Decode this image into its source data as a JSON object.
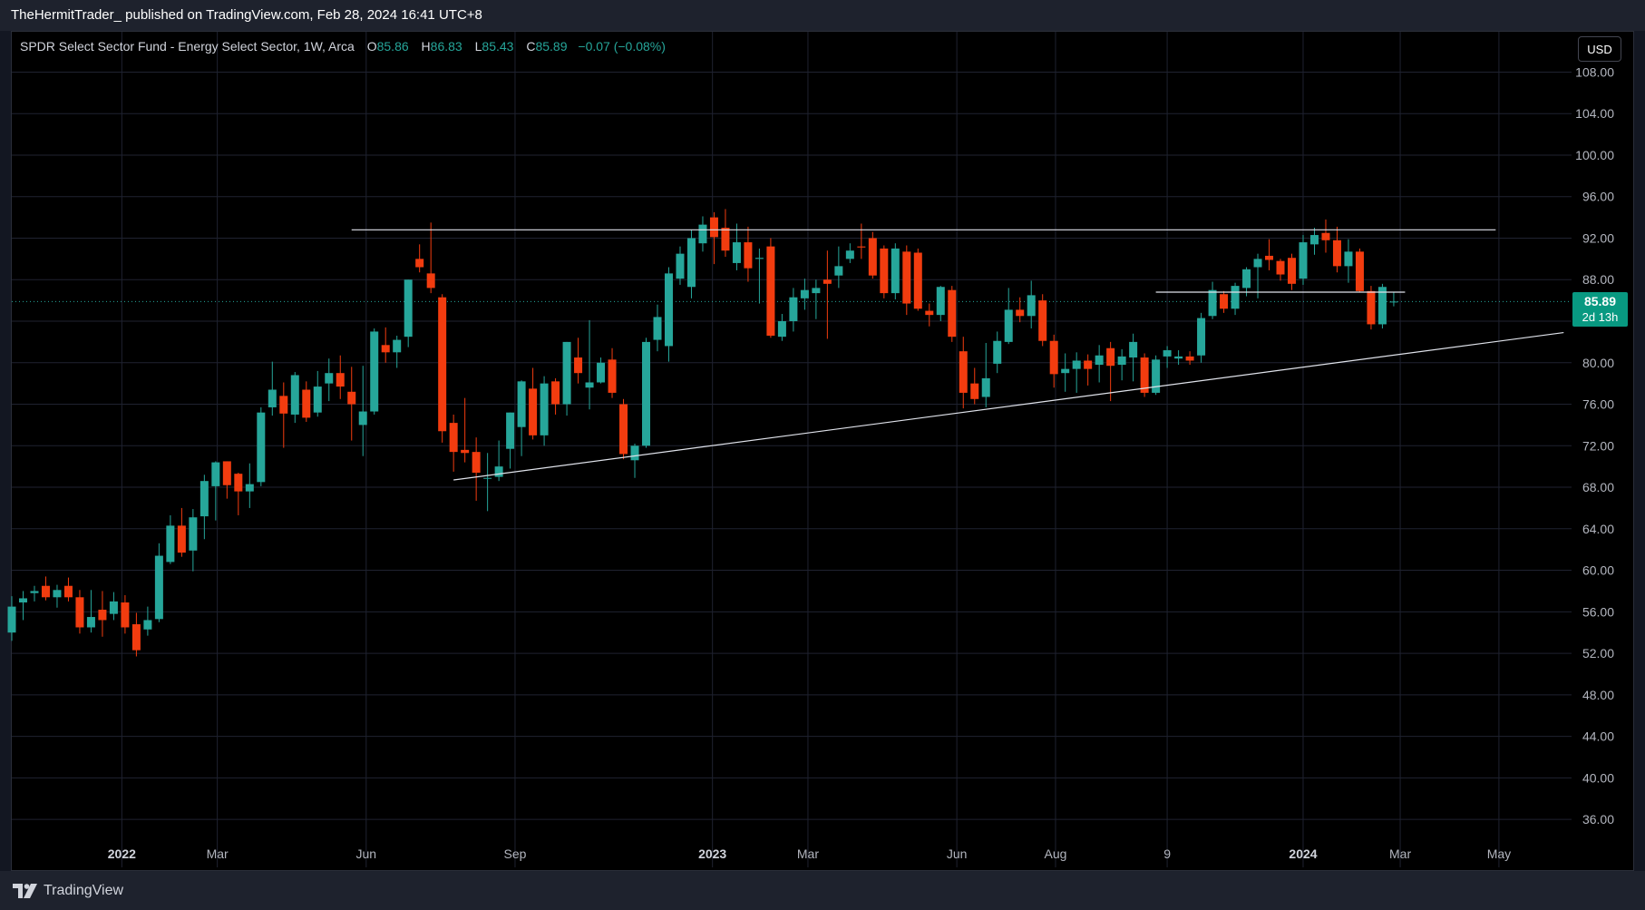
{
  "header": {
    "published_by": "TheHermitTrader_ published on TradingView.com, Feb 28, 2024 16:41 UTC+8"
  },
  "legend": {
    "symbol": "SPDR Select Sector Fund - Energy Select Sector, 1W, Arca",
    "open_key": "O",
    "open": "85.86",
    "high_key": "H",
    "high": "86.83",
    "low_key": "L",
    "low": "85.43",
    "close_key": "C",
    "close": "85.89",
    "change": "−0.07 (−0.08%)"
  },
  "currency_button": "USD",
  "price_badge": {
    "price": "85.89",
    "countdown": "2d 13h"
  },
  "footer": {
    "brand": "TradingView",
    "logo_icon": "tradingview-logo-icon"
  },
  "colors": {
    "up": "#26a69a",
    "down": "#f23c0f",
    "background": "#000000",
    "grid": "#1f2230",
    "axis_text": "#b2b5be",
    "trendline": "#e0e3eb",
    "last_price_line": "#26a69a"
  },
  "chart_data": {
    "type": "candlestick",
    "timeframe": "1W",
    "x_range": [
      "2021-10-25",
      "2024-06-16"
    ],
    "ylim": [
      34,
      109
    ],
    "y_ticks": [
      "108.00",
      "104.00",
      "100.00",
      "96.00",
      "92.00",
      "88.00",
      "84.00",
      "80.00",
      "76.00",
      "72.00",
      "68.00",
      "64.00",
      "60.00",
      "56.00",
      "52.00",
      "48.00",
      "44.00",
      "40.00",
      "36.00"
    ],
    "x_ticks": [
      {
        "date": "2022-01-01",
        "label": "2022",
        "bold": true
      },
      {
        "date": "2022-03-01",
        "label": "Mar"
      },
      {
        "date": "2022-06-01",
        "label": "Jun"
      },
      {
        "date": "2022-09-01",
        "label": "Sep"
      },
      {
        "date": "2023-01-01",
        "label": "2023",
        "bold": true
      },
      {
        "date": "2023-03-01",
        "label": "Mar"
      },
      {
        "date": "2023-06-01",
        "label": "Jun"
      },
      {
        "date": "2023-08-01",
        "label": "Aug"
      },
      {
        "date": "2023-10-09",
        "label": "9"
      },
      {
        "date": "2024-01-01",
        "label": "2024",
        "bold": true
      },
      {
        "date": "2024-03-01",
        "label": "Mar"
      },
      {
        "date": "2024-05-01",
        "label": "May"
      }
    ],
    "last_price": 85.89,
    "grid": true,
    "candles": [
      {
        "date": "2021-10-25",
        "o": 54.0,
        "h": 57.5,
        "l": 53.2,
        "c": 56.5
      },
      {
        "date": "2021-11-01",
        "o": 56.9,
        "h": 58.0,
        "l": 55.2,
        "c": 57.3
      },
      {
        "date": "2021-11-08",
        "o": 57.8,
        "h": 58.5,
        "l": 57.0,
        "c": 58.0
      },
      {
        "date": "2021-11-15",
        "o": 58.5,
        "h": 59.4,
        "l": 57.1,
        "c": 57.4
      },
      {
        "date": "2021-11-22",
        "o": 57.4,
        "h": 58.6,
        "l": 56.4,
        "c": 58.1
      },
      {
        "date": "2021-11-29",
        "o": 58.5,
        "h": 59.3,
        "l": 57.0,
        "c": 57.4
      },
      {
        "date": "2021-12-06",
        "o": 57.4,
        "h": 58.1,
        "l": 53.9,
        "c": 54.5
      },
      {
        "date": "2021-12-13",
        "o": 54.5,
        "h": 58.1,
        "l": 54.0,
        "c": 55.5
      },
      {
        "date": "2021-12-20",
        "o": 56.2,
        "h": 58.0,
        "l": 53.6,
        "c": 55.2
      },
      {
        "date": "2021-12-27",
        "o": 55.8,
        "h": 57.9,
        "l": 55.2,
        "c": 57.0
      },
      {
        "date": "2022-01-03",
        "o": 56.9,
        "h": 57.6,
        "l": 53.9,
        "c": 54.5
      },
      {
        "date": "2022-01-10",
        "o": 54.8,
        "h": 55.9,
        "l": 51.7,
        "c": 52.3
      },
      {
        "date": "2022-01-17",
        "o": 54.3,
        "h": 56.5,
        "l": 53.7,
        "c": 55.2
      },
      {
        "date": "2022-01-24",
        "o": 55.3,
        "h": 62.6,
        "l": 55.0,
        "c": 61.4
      },
      {
        "date": "2022-01-31",
        "o": 60.8,
        "h": 65.3,
        "l": 60.6,
        "c": 64.3
      },
      {
        "date": "2022-02-07",
        "o": 64.3,
        "h": 66.0,
        "l": 61.3,
        "c": 61.7
      },
      {
        "date": "2022-02-14",
        "o": 61.9,
        "h": 65.9,
        "l": 59.9,
        "c": 65.1
      },
      {
        "date": "2022-02-21",
        "o": 65.2,
        "h": 69.2,
        "l": 63.0,
        "c": 68.6
      },
      {
        "date": "2022-02-28",
        "o": 68.1,
        "h": 70.5,
        "l": 64.8,
        "c": 70.4
      },
      {
        "date": "2022-03-07",
        "o": 70.5,
        "h": 70.5,
        "l": 66.9,
        "c": 68.2
      },
      {
        "date": "2022-03-14",
        "o": 69.3,
        "h": 69.4,
        "l": 65.3,
        "c": 67.6
      },
      {
        "date": "2022-03-21",
        "o": 67.6,
        "h": 70.3,
        "l": 66.0,
        "c": 68.3
      },
      {
        "date": "2022-03-28",
        "o": 68.5,
        "h": 75.7,
        "l": 68.1,
        "c": 75.2
      },
      {
        "date": "2022-04-04",
        "o": 75.7,
        "h": 80.1,
        "l": 74.9,
        "c": 77.4
      },
      {
        "date": "2022-04-11",
        "o": 76.8,
        "h": 78.1,
        "l": 71.8,
        "c": 75.1
      },
      {
        "date": "2022-04-18",
        "o": 75.0,
        "h": 79.1,
        "l": 74.2,
        "c": 78.8
      },
      {
        "date": "2022-04-25",
        "o": 77.4,
        "h": 78.2,
        "l": 74.3,
        "c": 74.7
      },
      {
        "date": "2022-05-02",
        "o": 75.2,
        "h": 79.2,
        "l": 74.8,
        "c": 77.7
      },
      {
        "date": "2022-05-09",
        "o": 78.0,
        "h": 80.4,
        "l": 76.3,
        "c": 79.0
      },
      {
        "date": "2022-05-16",
        "o": 79.0,
        "h": 80.7,
        "l": 76.5,
        "c": 77.7
      },
      {
        "date": "2022-05-23",
        "o": 77.2,
        "h": 79.6,
        "l": 72.5,
        "c": 76.0
      },
      {
        "date": "2022-05-30",
        "o": 74.0,
        "h": 79.7,
        "l": 71.0,
        "c": 75.3
      },
      {
        "date": "2022-06-06",
        "o": 75.3,
        "h": 83.3,
        "l": 75.0,
        "c": 83.0
      },
      {
        "date": "2022-06-13",
        "o": 81.7,
        "h": 83.4,
        "l": 80.0,
        "c": 81.0
      },
      {
        "date": "2022-06-20",
        "o": 81.0,
        "h": 82.6,
        "l": 79.5,
        "c": 82.2
      },
      {
        "date": "2022-06-27",
        "o": 82.5,
        "h": 88.0,
        "l": 81.5,
        "c": 88.0
      },
      {
        "date": "2022-07-04",
        "o": 90.0,
        "h": 91.4,
        "l": 88.7,
        "c": 89.2
      },
      {
        "date": "2022-07-11",
        "o": 88.6,
        "h": 93.5,
        "l": 86.7,
        "c": 87.2
      },
      {
        "date": "2022-07-18",
        "o": 86.3,
        "h": 86.6,
        "l": 72.3,
        "c": 73.4
      },
      {
        "date": "2022-07-25",
        "o": 74.2,
        "h": 75.0,
        "l": 69.5,
        "c": 71.4
      },
      {
        "date": "2022-08-01",
        "o": 71.6,
        "h": 76.6,
        "l": 70.4,
        "c": 71.3
      },
      {
        "date": "2022-08-08",
        "o": 71.4,
        "h": 72.8,
        "l": 66.7,
        "c": 69.4
      },
      {
        "date": "2022-08-15",
        "o": 68.9,
        "h": 71.3,
        "l": 65.7,
        "c": 68.9
      },
      {
        "date": "2022-08-22",
        "o": 69.0,
        "h": 72.5,
        "l": 68.6,
        "c": 70.0
      },
      {
        "date": "2022-08-29",
        "o": 71.7,
        "h": 75.2,
        "l": 69.8,
        "c": 75.2
      },
      {
        "date": "2022-09-05",
        "o": 73.8,
        "h": 78.3,
        "l": 71.0,
        "c": 78.2
      },
      {
        "date": "2022-09-12",
        "o": 77.5,
        "h": 79.5,
        "l": 72.6,
        "c": 73.0
      },
      {
        "date": "2022-09-19",
        "o": 73.0,
        "h": 78.7,
        "l": 72.0,
        "c": 78.0
      },
      {
        "date": "2022-09-26",
        "o": 78.2,
        "h": 78.5,
        "l": 75.0,
        "c": 76.0
      },
      {
        "date": "2022-10-03",
        "o": 76.0,
        "h": 82.0,
        "l": 74.9,
        "c": 82.0
      },
      {
        "date": "2022-10-10",
        "o": 80.5,
        "h": 82.4,
        "l": 78.0,
        "c": 79.0
      },
      {
        "date": "2022-10-17",
        "o": 77.6,
        "h": 84.1,
        "l": 75.5,
        "c": 78.1
      },
      {
        "date": "2022-10-24",
        "o": 78.1,
        "h": 80.5,
        "l": 78.0,
        "c": 80.0
      },
      {
        "date": "2022-10-31",
        "o": 80.3,
        "h": 81.4,
        "l": 76.6,
        "c": 77.1
      },
      {
        "date": "2022-11-07",
        "o": 76.0,
        "h": 76.5,
        "l": 70.7,
        "c": 71.2
      },
      {
        "date": "2022-11-14",
        "o": 70.6,
        "h": 72.2,
        "l": 68.9,
        "c": 72.0
      },
      {
        "date": "2022-11-21",
        "o": 72.0,
        "h": 82.4,
        "l": 71.8,
        "c": 82.0
      },
      {
        "date": "2022-11-28",
        "o": 82.2,
        "h": 85.6,
        "l": 81.1,
        "c": 84.4
      },
      {
        "date": "2022-12-05",
        "o": 81.6,
        "h": 89.2,
        "l": 80.1,
        "c": 88.6
      },
      {
        "date": "2022-12-12",
        "o": 88.1,
        "h": 91.2,
        "l": 87.5,
        "c": 90.5
      },
      {
        "date": "2022-12-19",
        "o": 87.3,
        "h": 92.8,
        "l": 86.2,
        "c": 92.0
      },
      {
        "date": "2022-12-26",
        "o": 91.5,
        "h": 94.1,
        "l": 90.7,
        "c": 93.3
      },
      {
        "date": "2023-01-02",
        "o": 94.0,
        "h": 94.5,
        "l": 89.5,
        "c": 92.1
      },
      {
        "date": "2023-01-09",
        "o": 93.0,
        "h": 94.8,
        "l": 90.2,
        "c": 90.8
      },
      {
        "date": "2023-01-16",
        "o": 89.6,
        "h": 93.4,
        "l": 88.9,
        "c": 91.6
      },
      {
        "date": "2023-01-23",
        "o": 91.6,
        "h": 93.1,
        "l": 87.8,
        "c": 89.1
      },
      {
        "date": "2023-01-30",
        "o": 90.0,
        "h": 91.0,
        "l": 85.7,
        "c": 90.1
      },
      {
        "date": "2023-02-06",
        "o": 91.2,
        "h": 92.0,
        "l": 82.4,
        "c": 82.6
      },
      {
        "date": "2023-02-13",
        "o": 82.5,
        "h": 84.7,
        "l": 82.1,
        "c": 84.0
      },
      {
        "date": "2023-02-20",
        "o": 84.0,
        "h": 87.2,
        "l": 83.0,
        "c": 86.3
      },
      {
        "date": "2023-02-27",
        "o": 86.2,
        "h": 88.1,
        "l": 85.1,
        "c": 87.0
      },
      {
        "date": "2023-03-06",
        "o": 86.7,
        "h": 88.0,
        "l": 84.2,
        "c": 87.2
      },
      {
        "date": "2023-03-13",
        "o": 88.0,
        "h": 90.8,
        "l": 82.3,
        "c": 87.6
      },
      {
        "date": "2023-03-20",
        "o": 88.4,
        "h": 91.2,
        "l": 87.2,
        "c": 89.3
      },
      {
        "date": "2023-03-27",
        "o": 90.0,
        "h": 91.5,
        "l": 89.6,
        "c": 90.8
      },
      {
        "date": "2023-04-03",
        "o": 91.2,
        "h": 93.4,
        "l": 90.0,
        "c": 91.1
      },
      {
        "date": "2023-04-10",
        "o": 92.0,
        "h": 92.6,
        "l": 88.1,
        "c": 88.4
      },
      {
        "date": "2023-04-17",
        "o": 91.0,
        "h": 91.3,
        "l": 86.2,
        "c": 86.7
      },
      {
        "date": "2023-04-24",
        "o": 86.7,
        "h": 91.5,
        "l": 86.1,
        "c": 91.0
      },
      {
        "date": "2023-05-01",
        "o": 90.7,
        "h": 91.3,
        "l": 84.6,
        "c": 85.7
      },
      {
        "date": "2023-05-08",
        "o": 90.6,
        "h": 91.0,
        "l": 85.0,
        "c": 85.2
      },
      {
        "date": "2023-05-15",
        "o": 85.0,
        "h": 85.7,
        "l": 83.5,
        "c": 84.6
      },
      {
        "date": "2023-05-22",
        "o": 84.6,
        "h": 87.4,
        "l": 84.0,
        "c": 87.3
      },
      {
        "date": "2023-05-29",
        "o": 87.0,
        "h": 87.4,
        "l": 82.0,
        "c": 82.5
      },
      {
        "date": "2023-06-05",
        "o": 81.1,
        "h": 82.5,
        "l": 75.6,
        "c": 77.1
      },
      {
        "date": "2023-06-12",
        "o": 78.0,
        "h": 79.5,
        "l": 76.0,
        "c": 76.5
      },
      {
        "date": "2023-06-19",
        "o": 76.7,
        "h": 81.9,
        "l": 75.7,
        "c": 78.5
      },
      {
        "date": "2023-06-26",
        "o": 79.9,
        "h": 83.0,
        "l": 79.0,
        "c": 82.1
      },
      {
        "date": "2023-07-03",
        "o": 82.0,
        "h": 87.2,
        "l": 81.8,
        "c": 85.1
      },
      {
        "date": "2023-07-10",
        "o": 85.1,
        "h": 86.3,
        "l": 83.9,
        "c": 84.5
      },
      {
        "date": "2023-07-17",
        "o": 84.5,
        "h": 87.9,
        "l": 83.3,
        "c": 86.5
      },
      {
        "date": "2023-07-24",
        "o": 86.0,
        "h": 86.6,
        "l": 81.6,
        "c": 82.1
      },
      {
        "date": "2023-07-31",
        "o": 82.1,
        "h": 82.7,
        "l": 77.6,
        "c": 78.9
      },
      {
        "date": "2023-08-07",
        "o": 79.0,
        "h": 80.9,
        "l": 77.2,
        "c": 79.4
      },
      {
        "date": "2023-08-14",
        "o": 79.4,
        "h": 81.0,
        "l": 77.1,
        "c": 80.2
      },
      {
        "date": "2023-08-21",
        "o": 80.2,
        "h": 80.8,
        "l": 77.8,
        "c": 79.4
      },
      {
        "date": "2023-08-28",
        "o": 79.8,
        "h": 81.7,
        "l": 78.1,
        "c": 80.7
      },
      {
        "date": "2023-09-04",
        "o": 81.4,
        "h": 82.0,
        "l": 76.3,
        "c": 79.7
      },
      {
        "date": "2023-09-11",
        "o": 79.8,
        "h": 81.3,
        "l": 78.3,
        "c": 80.6
      },
      {
        "date": "2023-09-18",
        "o": 80.5,
        "h": 82.8,
        "l": 78.2,
        "c": 82.0
      },
      {
        "date": "2023-09-25",
        "o": 80.5,
        "h": 80.9,
        "l": 76.7,
        "c": 77.1
      },
      {
        "date": "2023-10-02",
        "o": 77.1,
        "h": 80.7,
        "l": 76.9,
        "c": 80.3
      },
      {
        "date": "2023-10-09",
        "o": 80.6,
        "h": 81.6,
        "l": 79.5,
        "c": 81.2
      },
      {
        "date": "2023-10-16",
        "o": 80.4,
        "h": 81.2,
        "l": 79.8,
        "c": 80.6
      },
      {
        "date": "2023-10-23",
        "o": 80.6,
        "h": 81.1,
        "l": 79.8,
        "c": 80.2
      },
      {
        "date": "2023-10-30",
        "o": 80.7,
        "h": 84.8,
        "l": 80.0,
        "c": 84.3
      },
      {
        "date": "2023-11-06",
        "o": 84.5,
        "h": 87.8,
        "l": 84.2,
        "c": 87.0
      },
      {
        "date": "2023-11-13",
        "o": 86.6,
        "h": 86.9,
        "l": 84.8,
        "c": 85.2
      },
      {
        "date": "2023-11-20",
        "o": 85.2,
        "h": 87.7,
        "l": 84.6,
        "c": 87.4
      },
      {
        "date": "2023-11-27",
        "o": 87.2,
        "h": 89.2,
        "l": 86.4,
        "c": 89.0
      },
      {
        "date": "2023-12-04",
        "o": 89.2,
        "h": 90.5,
        "l": 86.2,
        "c": 90.0
      },
      {
        "date": "2023-12-11",
        "o": 90.3,
        "h": 91.9,
        "l": 88.9,
        "c": 89.9
      },
      {
        "date": "2023-12-18",
        "o": 89.8,
        "h": 90.0,
        "l": 87.9,
        "c": 88.5
      },
      {
        "date": "2023-12-25",
        "o": 90.1,
        "h": 90.5,
        "l": 87.0,
        "c": 87.6
      },
      {
        "date": "2024-01-01",
        "o": 88.1,
        "h": 92.3,
        "l": 87.5,
        "c": 91.6
      },
      {
        "date": "2024-01-08",
        "o": 91.4,
        "h": 93.0,
        "l": 90.4,
        "c": 92.3
      },
      {
        "date": "2024-01-15",
        "o": 92.5,
        "h": 93.8,
        "l": 90.6,
        "c": 91.8
      },
      {
        "date": "2024-01-22",
        "o": 91.8,
        "h": 93.1,
        "l": 88.7,
        "c": 89.3
      },
      {
        "date": "2024-01-29",
        "o": 89.3,
        "h": 91.9,
        "l": 87.7,
        "c": 90.7
      },
      {
        "date": "2024-02-05",
        "o": 90.7,
        "h": 91.0,
        "l": 86.8,
        "c": 86.9
      },
      {
        "date": "2024-02-12",
        "o": 86.9,
        "h": 87.4,
        "l": 83.2,
        "c": 83.7
      },
      {
        "date": "2024-02-19",
        "o": 83.7,
        "h": 87.6,
        "l": 83.3,
        "c": 87.3
      },
      {
        "date": "2024-02-26",
        "o": 85.86,
        "h": 86.83,
        "l": 85.43,
        "c": 85.89
      }
    ],
    "lines": [
      {
        "name": "resistance",
        "from": {
          "date": "2022-05-23",
          "price": 92.8
        },
        "to": {
          "date": "2024-04-29",
          "price": 92.8
        }
      },
      {
        "name": "ascending-support",
        "from": {
          "date": "2022-07-25",
          "price": 68.7
        },
        "to": {
          "date": "2024-06-10",
          "price": 82.9
        }
      },
      {
        "name": "range-top",
        "from": {
          "date": "2023-10-02",
          "price": 86.8
        },
        "to": {
          "date": "2024-03-04",
          "price": 86.8
        }
      }
    ]
  }
}
